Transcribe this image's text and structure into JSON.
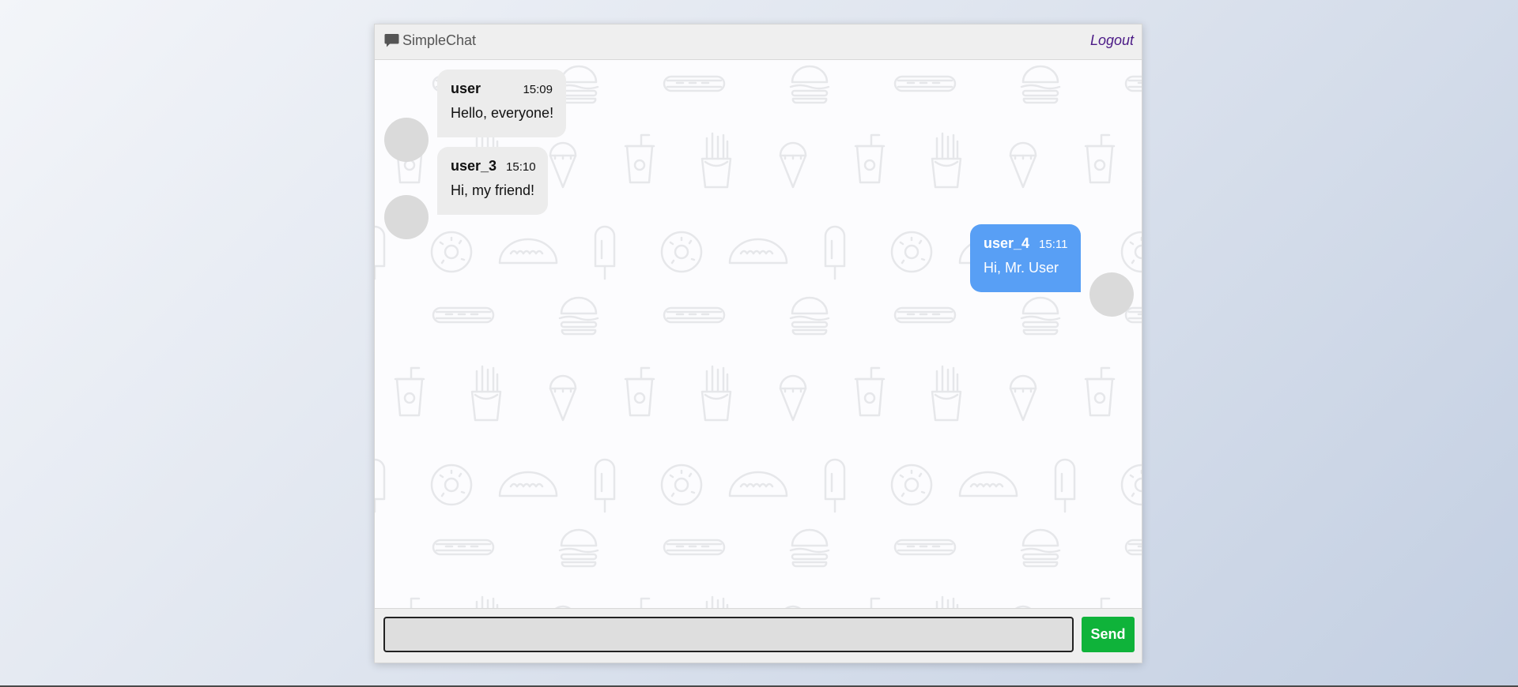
{
  "app": {
    "title": "SimpleChat",
    "logout_label": "Logout"
  },
  "messages": [
    {
      "user": "user",
      "time": "15:09",
      "text": "Hello, everyone!",
      "direction": "incoming"
    },
    {
      "user": "user_3",
      "time": "15:10",
      "text": "Hi, my friend!",
      "direction": "incoming"
    },
    {
      "user": "user_4",
      "time": "15:11",
      "text": "Hi, Mr. User",
      "direction": "outgoing"
    }
  ],
  "composer": {
    "input_value": "",
    "input_placeholder": "",
    "send_label": "Send"
  },
  "icons": {
    "brand": "chat-bubble-icon",
    "background_pattern": [
      "burger-icon",
      "hotdog-icon",
      "soda-cup-icon",
      "ice-cream-cone-icon",
      "fries-icon",
      "popsicle-icon",
      "donut-icon",
      "taco-icon"
    ]
  },
  "colors": {
    "incoming_bubble": "#ececec",
    "outgoing_bubble": "#589ff5",
    "send_button": "#0fb33a",
    "logout_link": "#4b1a86",
    "avatar": "#dadada"
  }
}
